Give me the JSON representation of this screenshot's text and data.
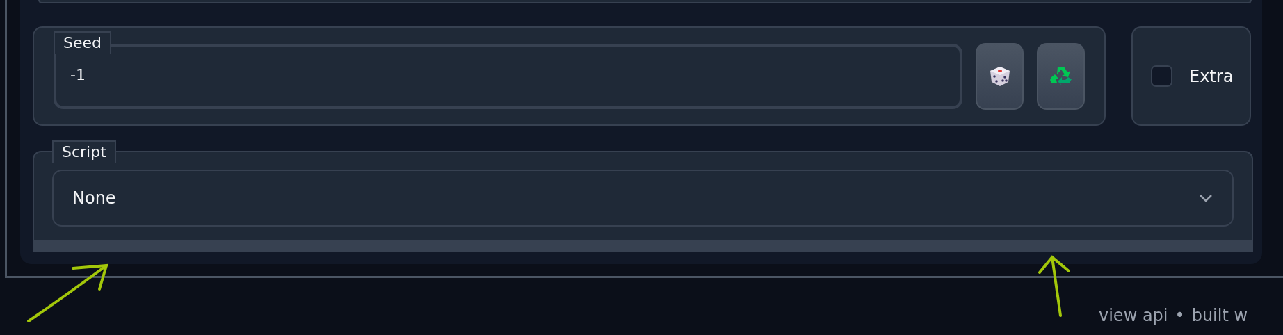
{
  "seed": {
    "label": "Seed",
    "value": "-1",
    "buttons": [
      {
        "kind": "dice"
      },
      {
        "kind": "recycle"
      }
    ]
  },
  "extra": {
    "label": "Extra",
    "checked": false
  },
  "script": {
    "label": "Script",
    "value": "None"
  },
  "footer": [
    "view api",
    "•",
    "built w"
  ]
}
